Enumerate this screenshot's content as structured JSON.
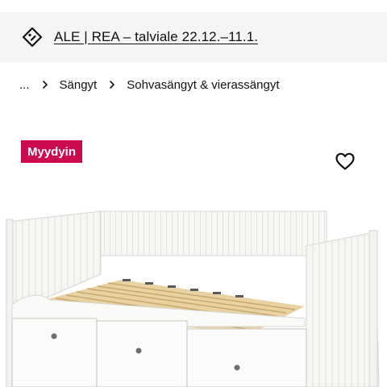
{
  "promo": {
    "icon": "price-tag-icon",
    "text": "ALE | REA – talviale 22.12.–11.1."
  },
  "breadcrumb": {
    "items": [
      "...",
      "Sängyt",
      "Sohvasängyt & vierassängyt"
    ],
    "separator_icon": "chevron-right-icon"
  },
  "product": {
    "badge": "Myydyin",
    "favorite_icon": "heart-icon",
    "image_description": "white-daybed-with-three-drawers"
  },
  "colors": {
    "badge_bg": "#cc0a4f",
    "banner_bg": "#f5f5f5",
    "text": "#111111"
  }
}
